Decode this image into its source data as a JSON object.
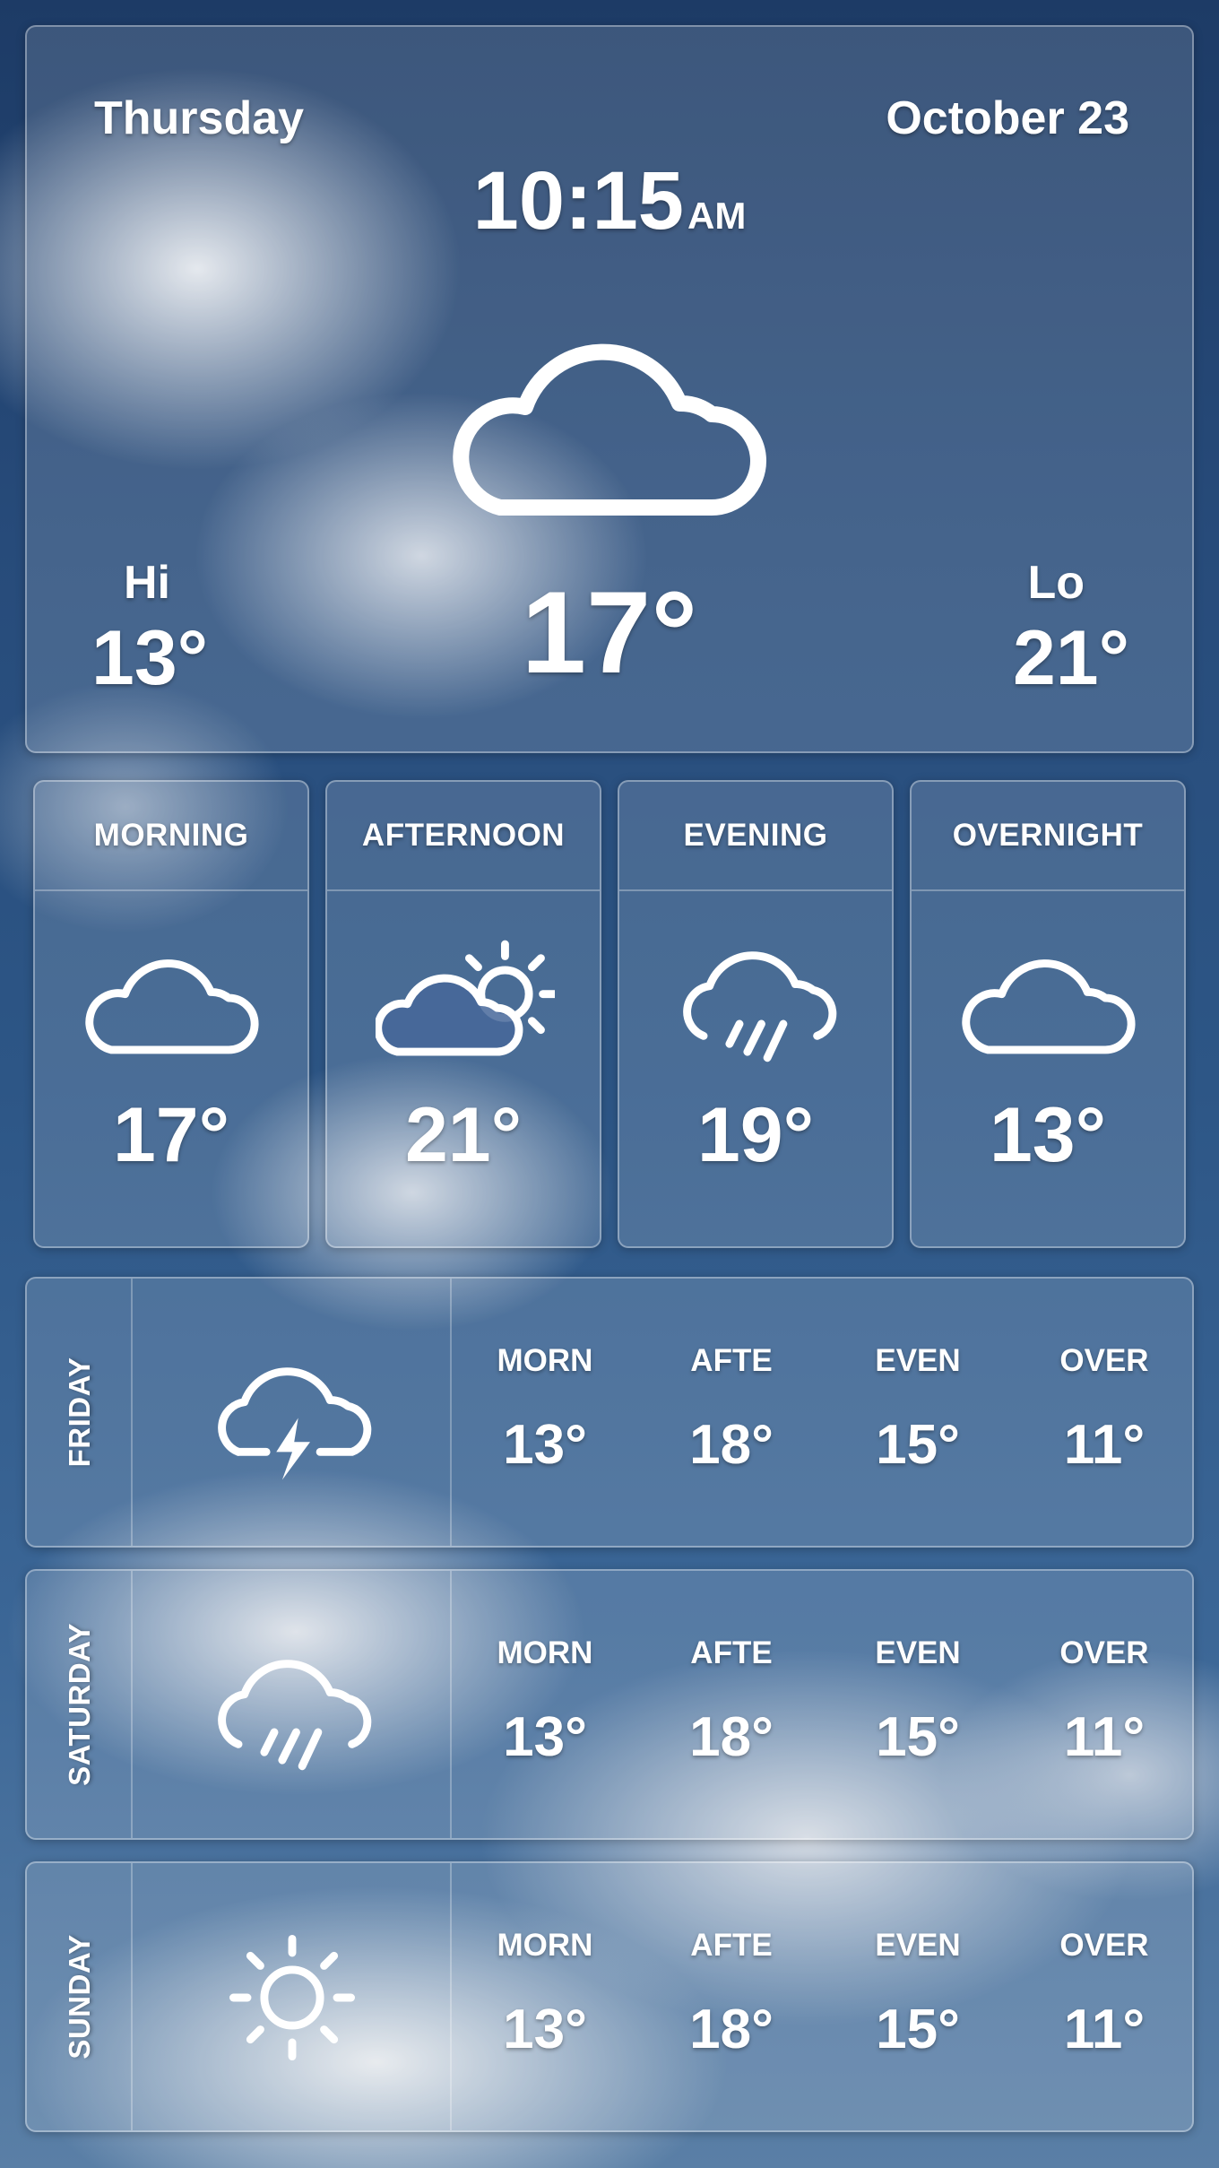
{
  "today": {
    "day": "Thursday",
    "date": "October 23",
    "time": "10:15",
    "ampm": "AM",
    "icon": "cloud-icon",
    "temperature": "17°",
    "hi_label": "Hi",
    "hi_value": "13°",
    "lo_label": "Lo",
    "lo_value": "21°"
  },
  "periods": [
    {
      "label": "MORNING",
      "icon": "cloud-icon",
      "temp": "17°"
    },
    {
      "label": "AFTERNOON",
      "icon": "partly-sunny-icon",
      "temp": "21°"
    },
    {
      "label": "EVENING",
      "icon": "rain-icon",
      "temp": "19°"
    },
    {
      "label": "OVERNIGHT",
      "icon": "cloud-icon",
      "temp": "13°"
    }
  ],
  "forecast": [
    {
      "day": "FRIDAY",
      "icon": "thunderstorm-icon",
      "slots": [
        {
          "label": "MORN",
          "temp": "13°"
        },
        {
          "label": "AFTE",
          "temp": "18°"
        },
        {
          "label": "EVEN",
          "temp": "15°"
        },
        {
          "label": "OVER",
          "temp": "11°"
        }
      ]
    },
    {
      "day": "SATURDAY",
      "icon": "rain-icon",
      "slots": [
        {
          "label": "MORN",
          "temp": "13°"
        },
        {
          "label": "AFTE",
          "temp": "18°"
        },
        {
          "label": "EVEN",
          "temp": "15°"
        },
        {
          "label": "OVER",
          "temp": "11°"
        }
      ]
    },
    {
      "day": "SUNDAY",
      "icon": "sun-icon",
      "slots": [
        {
          "label": "MORN",
          "temp": "13°"
        },
        {
          "label": "AFTE",
          "temp": "18°"
        },
        {
          "label": "EVEN",
          "temp": "15°"
        },
        {
          "label": "OVER",
          "temp": "11°"
        }
      ]
    }
  ]
}
